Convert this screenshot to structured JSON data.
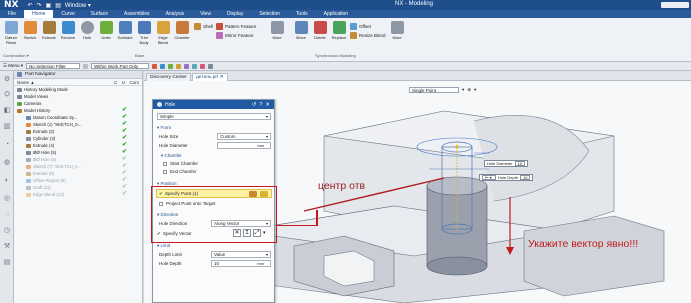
{
  "app": {
    "logo": "NX",
    "title": "NX - Modeling",
    "window_menu": "Window ▾",
    "quick_access": [
      "↶",
      "↷",
      "▣",
      "▤"
    ]
  },
  "menu": {
    "items": [
      "File",
      "Home",
      "Curve",
      "Surface",
      "Assemblies",
      "Analysis",
      "View",
      "Display",
      "Selection",
      "Tools",
      "Application"
    ],
    "active": "Home"
  },
  "ribbon": {
    "buttons": [
      {
        "label": "Datum\nPlane",
        "name": "datum-plane",
        "color": "#7fa7d6"
      },
      {
        "label": "Sketch",
        "name": "sketch",
        "color": "#e08a3a"
      },
      {
        "label": "Extrude",
        "name": "extrude",
        "color": "#a37c3a"
      },
      {
        "label": "Revolve",
        "name": "revolve",
        "color": "#3c8bd1"
      },
      {
        "label": "Hole",
        "name": "hole",
        "color": "#8e98a6"
      },
      {
        "label": "Unite",
        "name": "unite",
        "color": "#6fae3c"
      },
      {
        "label": "Subtract",
        "name": "subtract",
        "color": "#4f7fbd"
      },
      {
        "label": "Trim\nBody",
        "name": "trim-body",
        "color": "#4a7ab8"
      },
      {
        "label": "Edge\nBlend",
        "name": "edge-blend",
        "color": "#d9a33b"
      },
      {
        "label": "Chamfer",
        "name": "chamfer",
        "color": "#c87a3b"
      },
      {
        "label": "Shell",
        "name": "shell",
        "color": "#c98a36"
      },
      {
        "label": "Pattern Feature",
        "name": "pattern-feature",
        "color": "#cc4b3b"
      },
      {
        "label": "Mirror Feature",
        "name": "mirror-feature",
        "color": "#b96fb7"
      },
      {
        "label": "More",
        "name": "more",
        "color": "#8d96a4"
      },
      {
        "label": "Move",
        "name": "move",
        "color": "#5d86b9"
      },
      {
        "label": "Delete",
        "name": "delete",
        "color": "#c94a4a"
      },
      {
        "label": "Replace",
        "name": "replace",
        "color": "#4aa35a"
      },
      {
        "label": "Offset",
        "name": "offset",
        "color": "#5c9bd1"
      },
      {
        "label": "Resize Blend",
        "name": "resize-blend",
        "color": "#c78b35"
      },
      {
        "label": "More",
        "name": "more-2",
        "color": "#8d96a4"
      }
    ],
    "groups": [
      "Construction ▾",
      "Base",
      "Synchronous Modeling"
    ]
  },
  "toolbar2": {
    "menu_label": "☰ Menu ▾",
    "filter_label": "No Selection Filter",
    "scope_label": "Within Work Part Only"
  },
  "navigator": {
    "title": "Part Navigator",
    "col_name": "Name ▲",
    "col_c": "C",
    "col_u": "U",
    "col_comment": "Com",
    "rows": [
      {
        "text": "History Modeling Mode",
        "indent": 3,
        "icon": "#7c8594",
        "check": "",
        "dim": false
      },
      {
        "text": "Model Views",
        "indent": 3,
        "icon": "#7c8594",
        "check": "",
        "dim": false
      },
      {
        "text": "Cameras",
        "indent": 3,
        "icon": "#62a346",
        "check": "",
        "dim": false
      },
      {
        "text": "Model History",
        "indent": 3,
        "icon": "#b9742f",
        "check": "✔",
        "dim": false
      },
      {
        "text": "Datum Coordinate Sy...",
        "indent": 12,
        "icon": "#6d87b3",
        "check": "✔",
        "dim": false
      },
      {
        "text": "Sketch (1) \"SKETCH_0...",
        "indent": 12,
        "icon": "#e08a3a",
        "check": "✔",
        "dim": false
      },
      {
        "text": "Extrude (2)",
        "indent": 12,
        "icon": "#a37c3a",
        "check": "✔",
        "dim": false
      },
      {
        "text": "Cylinder (3)",
        "indent": 12,
        "icon": "#8a93a0",
        "check": "✔",
        "dim": false
      },
      {
        "text": "Extrude (4)",
        "indent": 12,
        "icon": "#a37c3a",
        "check": "✔",
        "dim": false
      },
      {
        "text": "ØØ Hole (5)",
        "indent": 12,
        "icon": "#7d8898",
        "check": "✔",
        "dim": false
      },
      {
        "text": "ØØ Hole (6)",
        "indent": 12,
        "icon": "#a4acb8",
        "check": "✔",
        "dim": true
      },
      {
        "text": "Sketch (7) \"SKETCH_0...",
        "indent": 12,
        "icon": "#e6b17c",
        "check": "✔",
        "dim": true
      },
      {
        "text": "Extrude (8)",
        "indent": 12,
        "icon": "#cfb890",
        "check": "✔",
        "dim": true
      },
      {
        "text": "Offset Region (9)",
        "indent": 12,
        "icon": "#a5c3e0",
        "check": "✔",
        "dim": true
      },
      {
        "text": "Draft (11)",
        "indent": 12,
        "icon": "#b8c0cc",
        "check": "✔",
        "dim": true
      },
      {
        "text": "Edge Blend (12)",
        "indent": 12,
        "icon": "#e6cf9a",
        "check": "✔",
        "dim": true
      }
    ]
  },
  "tabs": {
    "discovery": "Discovery Center",
    "part": "деталь.prt ✕"
  },
  "viewport": {
    "selection_mode": "Single Point"
  },
  "dialog": {
    "title": "Hole",
    "type_value": "Simple",
    "form_section": "Form",
    "hole_size_label": "Hole Size",
    "hole_size_value": "Custom",
    "hole_diameter_label": "Hole Diameter",
    "hole_diameter_unit": "mm",
    "chamfer_section": "Chamfer",
    "start_chamfer": "Start Chamfer",
    "end_chamfer": "End Chamfer",
    "position_section": "Position",
    "specify_point": "Specify Point (1)",
    "project_point": "Project Point onto Target",
    "direction_section": "Direction",
    "hole_direction_label": "Hole Direction",
    "hole_direction_value": "Along Vector",
    "specify_vector": "Specify Vector",
    "limit_section": "Limit",
    "depth_limit_label": "Depth Limit",
    "depth_limit_value": "Value",
    "hole_depth_label": "Hole Depth",
    "hole_depth_value": "10",
    "hole_depth_unit": "mm"
  },
  "callouts": {
    "diameter_label": "Hole Diameter",
    "diameter_value": "10",
    "depth_label": "Hole Depth",
    "depth_value": "10"
  },
  "annotations": {
    "center_label": "центр отв",
    "vector_label": "Укажите вектор явно!!!",
    "center_color": "#9a1b1b",
    "vector_color": "#c41a1a"
  }
}
